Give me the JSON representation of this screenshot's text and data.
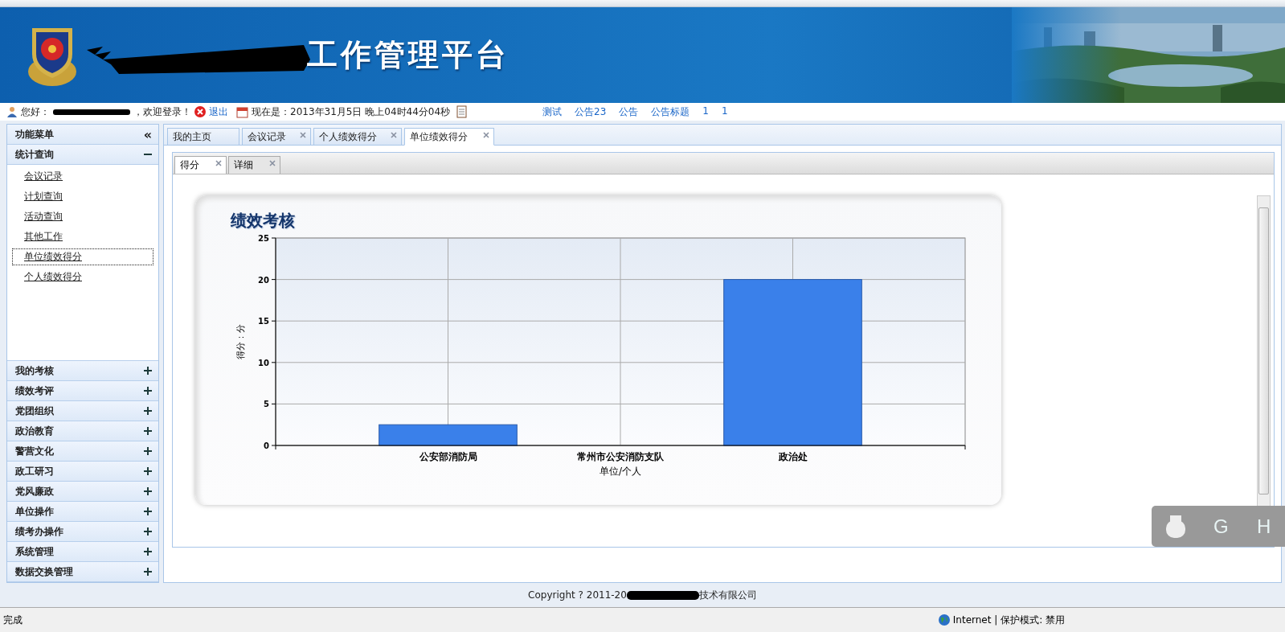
{
  "header": {
    "title": "工作管理平台"
  },
  "info_bar": {
    "greeting_start": "您好：",
    "greeting_end": "，欢迎登录！",
    "logout": "退出",
    "datetime": "现在是：2013年31月5日 晚上04时44分04秒",
    "links": [
      "测试",
      "公告23",
      "公告",
      "公告标题",
      "1",
      "1"
    ]
  },
  "sidebar": {
    "title": "功能菜单",
    "collapse": "«",
    "groups": [
      {
        "label": "统计查询",
        "expanded": true,
        "items": [
          {
            "label": "会议记录",
            "selected": false
          },
          {
            "label": "计划查询",
            "selected": false
          },
          {
            "label": "活动查询",
            "selected": false
          },
          {
            "label": "其他工作",
            "selected": false
          },
          {
            "label": "单位绩效得分",
            "selected": true
          },
          {
            "label": "个人绩效得分",
            "selected": false
          }
        ]
      },
      {
        "label": "我的考核",
        "expanded": false
      },
      {
        "label": "绩效考评",
        "expanded": false
      },
      {
        "label": "党团组织",
        "expanded": false
      },
      {
        "label": "政治教育",
        "expanded": false
      },
      {
        "label": "警营文化",
        "expanded": false
      },
      {
        "label": "政工研习",
        "expanded": false
      },
      {
        "label": "党风廉政",
        "expanded": false
      },
      {
        "label": "单位操作",
        "expanded": false
      },
      {
        "label": "绩考办操作",
        "expanded": false
      },
      {
        "label": "系统管理",
        "expanded": false
      },
      {
        "label": "数据交换管理",
        "expanded": false
      }
    ]
  },
  "tabs": [
    {
      "label": "我的主页",
      "closable": false,
      "selected": false
    },
    {
      "label": "会议记录",
      "closable": true,
      "selected": false
    },
    {
      "label": "个人绩效得分",
      "closable": true,
      "selected": false
    },
    {
      "label": "单位绩效得分",
      "closable": true,
      "selected": true
    }
  ],
  "inner_tabs": [
    {
      "label": "得分",
      "closable": true,
      "selected": true
    },
    {
      "label": "详细",
      "closable": true,
      "selected": false
    }
  ],
  "chart": {
    "title": "绩效考核",
    "chart_data": {
      "type": "bar",
      "xlabel": "单位/个人",
      "ylabel": "得分：分",
      "categories": [
        "公安部消防局",
        "常州市公安消防支队",
        "政治处"
      ],
      "series": [
        {
          "color": "#3a80ea",
          "values": [
            2.5,
            0,
            20
          ]
        }
      ],
      "grid": true,
      "ylim": [
        0,
        25
      ],
      "yticks": [
        0,
        5,
        10,
        15,
        20,
        25
      ]
    }
  },
  "overlay": {
    "keys": [
      "G",
      "H"
    ]
  },
  "footer": {
    "copyright_start": "Copyright ? 2011-20",
    "copyright_end": "技术有限公司"
  },
  "status_bar": {
    "left": "完成",
    "zone": "Internet | 保护模式: 禁用"
  }
}
